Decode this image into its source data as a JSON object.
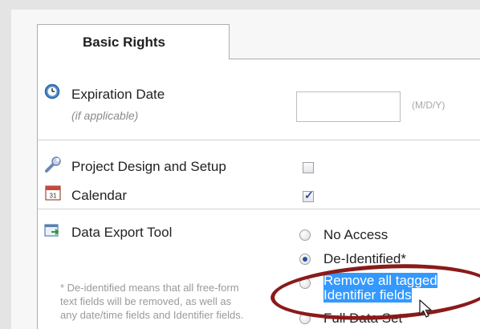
{
  "tab": {
    "label": "Basic Rights"
  },
  "expiration": {
    "label": "Expiration Date",
    "sublabel": "(if applicable)",
    "input_value": "",
    "hint": "(M/D/Y)"
  },
  "rights": [
    {
      "label": "Project Design and Setup",
      "checked": false
    },
    {
      "label": "Calendar",
      "checked": true
    }
  ],
  "data_export": {
    "label": "Data Export Tool",
    "note": "* De-identified means that all free-form text fields will be removed, as well as any date/time fields and Identifier fields.",
    "options": [
      {
        "label": "No Access",
        "selected": false
      },
      {
        "label": "De-Identified*",
        "selected": true
      },
      {
        "label": "Remove all tagged Identifier fields",
        "selected": false
      },
      {
        "label": "Full Data Set",
        "selected": false
      }
    ]
  },
  "colors": {
    "highlight": "#3399ff",
    "annotation_ellipse": "#8b1a1a",
    "radio_selected": "#2a4f9c"
  }
}
